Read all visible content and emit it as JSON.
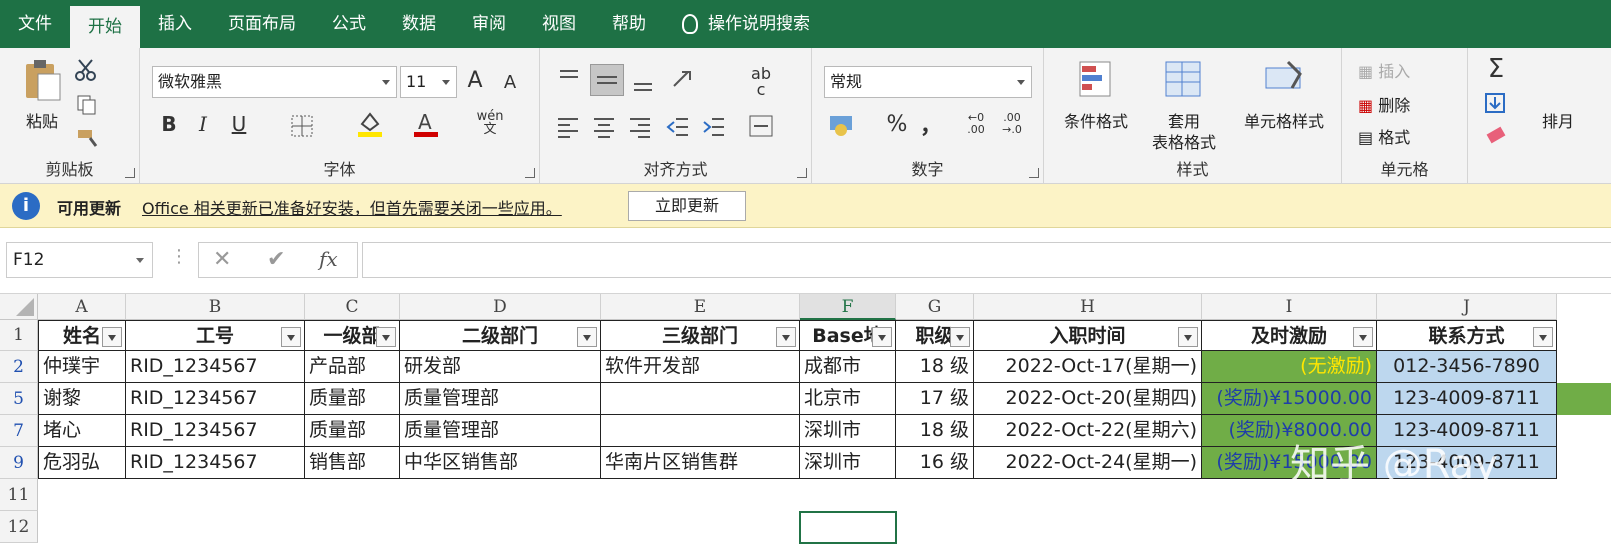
{
  "tabs": [
    "文件",
    "开始",
    "插入",
    "页面布局",
    "公式",
    "数据",
    "审阅",
    "视图",
    "帮助"
  ],
  "tell_me": "操作说明搜索",
  "ribbon": {
    "clipboard": {
      "paste": "粘贴",
      "label": "剪贴板"
    },
    "font": {
      "name": "微软雅黑",
      "size": "11",
      "wen": "wén",
      "wen2": "文",
      "label": "字体",
      "bold": "B",
      "italic": "I",
      "underline": "U"
    },
    "align": {
      "label": "对齐方式",
      "abc": "ab",
      "abc2": "c"
    },
    "number": {
      "format": "常规",
      "label": "数字",
      "pct": "%",
      "comma": "，",
      "inc": "←0\n.00",
      "dec": ".00\n→.0"
    },
    "styles": {
      "cond": "条件格式",
      "table1": "套用",
      "table2": "表格格式",
      "cell": "单元格样式",
      "label": "样式"
    },
    "cells": {
      "insert": "插入",
      "delete": "删除",
      "format": "格式",
      "label": "单元格"
    },
    "editing": {
      "sort": "排月"
    }
  },
  "update": {
    "title": "可用更新",
    "message": "Office 相关更新已准备好安装，但首先需要关闭一些应用。",
    "button": "立即更新"
  },
  "namebox": "F12",
  "fx": "fx",
  "columns": [
    "A",
    "B",
    "C",
    "D",
    "E",
    "F",
    "G",
    "H",
    "I",
    "J"
  ],
  "rows": [
    "1",
    "2",
    "5",
    "7",
    "9",
    "11",
    "12"
  ],
  "headers": [
    "姓名",
    "工号",
    "一级部",
    "二级部门",
    "三级部门",
    "Base地",
    "职级",
    "入职时间",
    "及时激励",
    "联系方式"
  ],
  "data": [
    [
      "仲璞宇",
      "RID_1234567",
      "产品部",
      "研发部",
      "软件开发部",
      "成都市",
      "18 级",
      "2022-Oct-17(星期一)",
      "(无激励)",
      "012-3456-7890"
    ],
    [
      "谢黎",
      "RID_1234567",
      "质量部",
      "质量管理部",
      "",
      "北京市",
      "17 级",
      "2022-Oct-20(星期四)",
      "(奖励)¥15000.00",
      "123-4009-8711"
    ],
    [
      "堵心",
      "RID_1234567",
      "质量部",
      "质量管理部",
      "",
      "深圳市",
      "18 级",
      "2022-Oct-22(星期六)",
      "(奖励)¥8000.00",
      "123-4009-8711"
    ],
    [
      "危羽弘",
      "RID_1234567",
      "销售部",
      "中华区销售部",
      "华南片区销售群",
      "深圳市",
      "16 级",
      "2022-Oct-24(星期一)",
      "(奖励)¥15000.00",
      "123-4009-8711"
    ]
  ],
  "watermark": "知乎 @Ray",
  "colors": {
    "brand": "#1e7145",
    "green_fill": "#70ad47",
    "blue_fill": "#bdd7ee"
  }
}
